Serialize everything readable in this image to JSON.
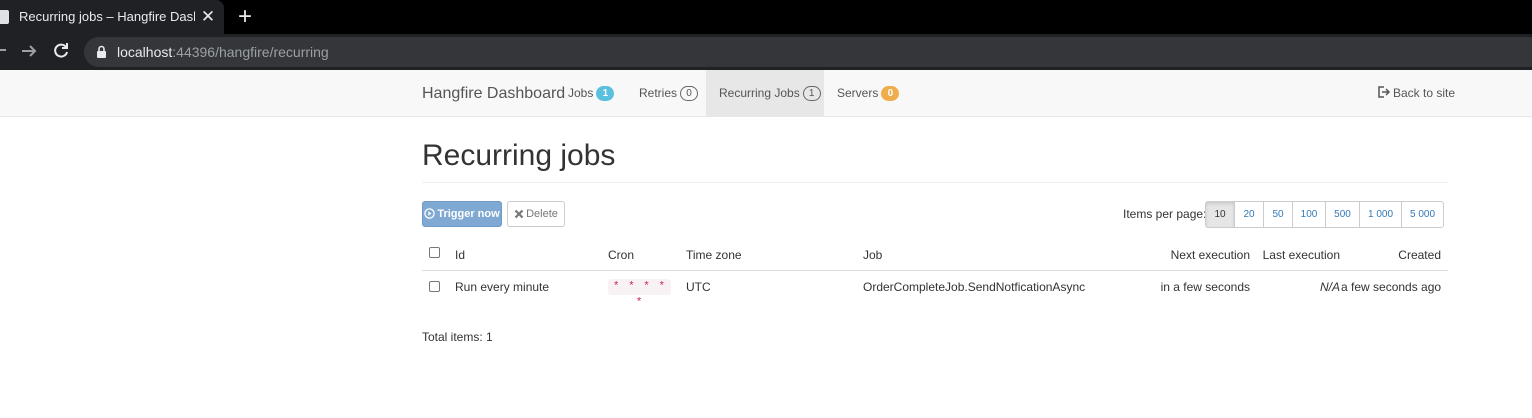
{
  "browser": {
    "tab_title": "Recurring jobs – Hangfire Dashbo",
    "tab_close": "✕",
    "new_tab": "+",
    "url_host": "localhost",
    "url_path": ":44396/hangfire/recurring"
  },
  "navbar": {
    "brand": "Hangfire Dashboard",
    "items": [
      {
        "label": "Jobs",
        "badge": "1"
      },
      {
        "label": "Retries",
        "badge": "0"
      },
      {
        "label": "Recurring Jobs",
        "badge": "1"
      },
      {
        "label": "Servers",
        "badge": "0"
      }
    ],
    "back_to_site": "Back to site"
  },
  "page": {
    "title": "Recurring jobs",
    "trigger_now": "Trigger now",
    "delete": "Delete",
    "items_per_page_label": "Items per page:",
    "page_sizes": [
      "10",
      "20",
      "50",
      "100",
      "500",
      "1 000",
      "5 000"
    ],
    "selected_page_size": "10",
    "total_items": "Total items: 1"
  },
  "table": {
    "columns": [
      "Id",
      "Cron",
      "Time zone",
      "Job",
      "Next execution",
      "Last execution",
      "Created"
    ],
    "rows": [
      {
        "id": "Run every minute",
        "cron": "* * * * *",
        "time_zone": "UTC",
        "job": "OrderCompleteJob.SendNotficationAsync",
        "next_execution": "in a few seconds",
        "last_execution": "N/A",
        "created": "a few seconds ago"
      }
    ]
  },
  "icons": {
    "trigger": "play-circle-icon",
    "delete": "remove-icon",
    "back": "log-out-icon",
    "lock": "lock-icon"
  },
  "colors": {
    "brand_text": "#555555",
    "badge_info": "#5bc0de",
    "badge_warning": "#f0ad4e",
    "primary_button": "#7fa8d3",
    "cron_text": "#c7254e",
    "link": "#337ab7"
  }
}
